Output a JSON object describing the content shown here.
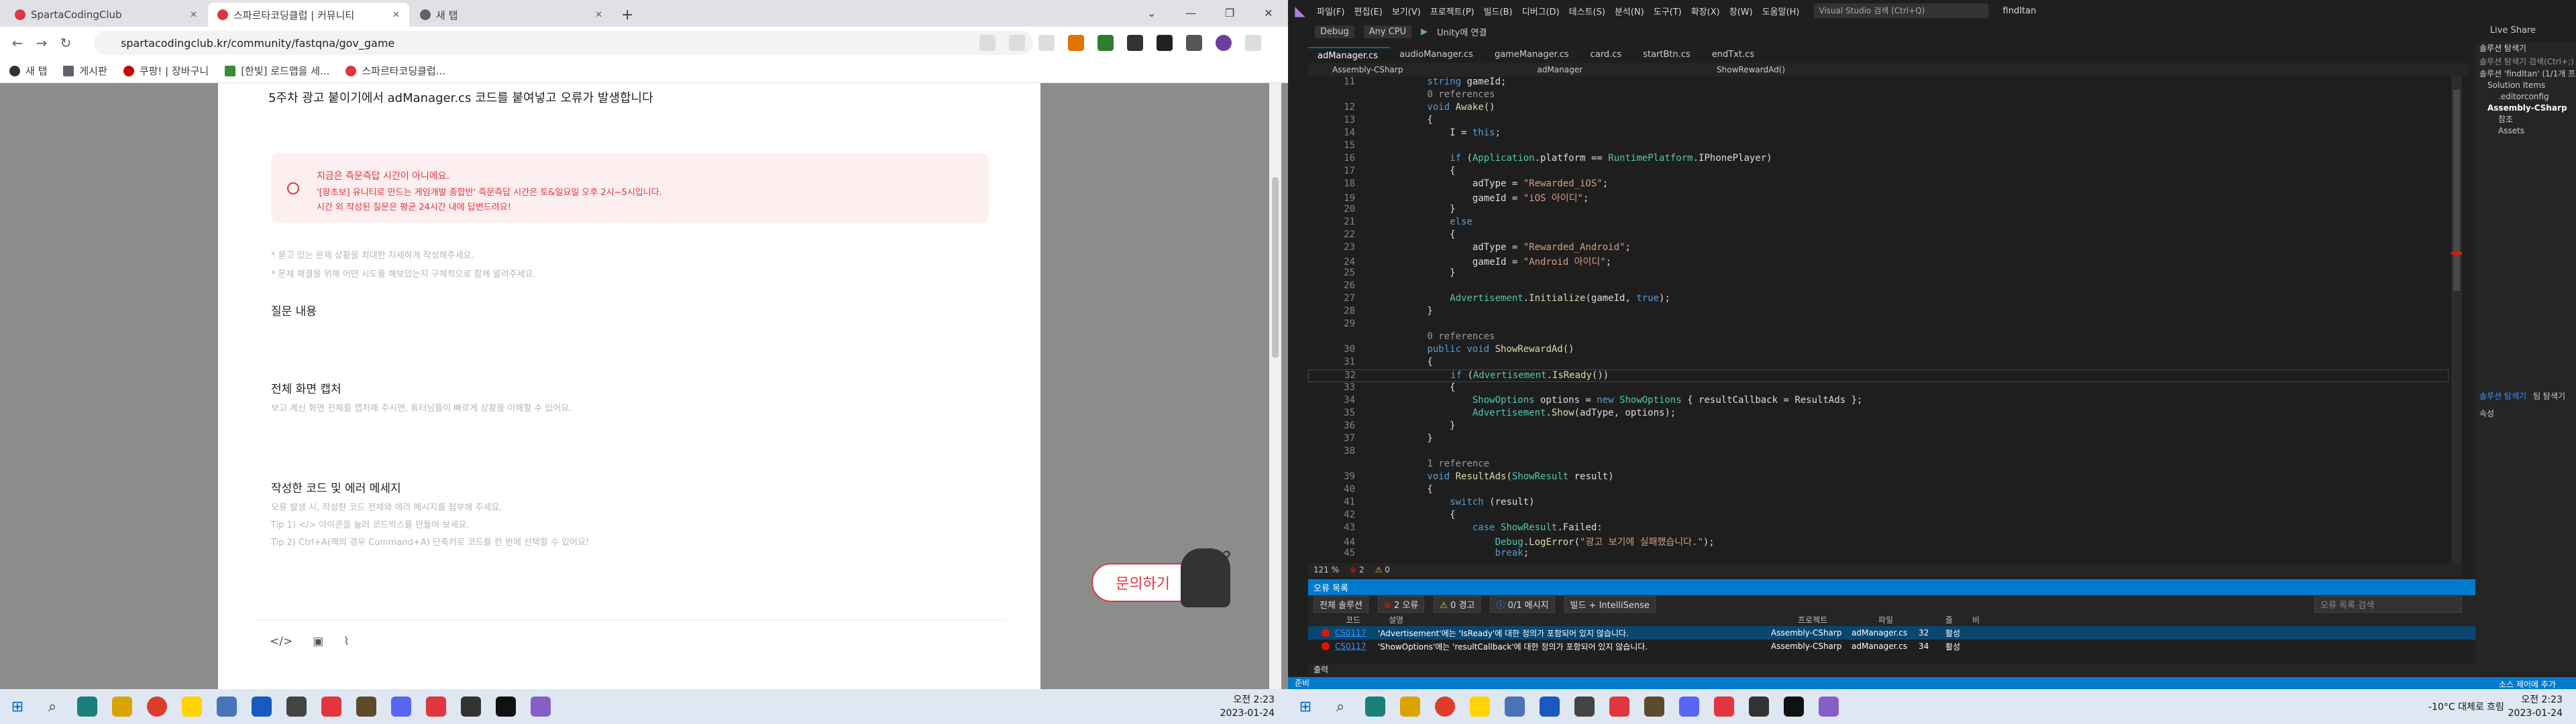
{
  "browser": {
    "tabs": [
      {
        "title": "SpartaCodingClub",
        "color": "#e1353f"
      },
      {
        "title": "스파르타코딩클럽 | 커뮤니티",
        "color": "#e1353f"
      },
      {
        "title": "새 탭",
        "color": "#5f6368"
      }
    ],
    "new_tab": "+",
    "url": "spartacodingclub.kr/community/fastqna/gov_game",
    "bookmarks": [
      "새 탭",
      "게시판",
      "쿠팡! | 장바구니",
      "[한빛] 로드맵을 세...",
      "스파르타코딩클럽..."
    ]
  },
  "page": {
    "question_title": "5주차 광고 붙이기에서 adManager.cs 코드를 붙여넣고 오류가 발생합니다",
    "notice_title": "지금은 즉문즉답 시간이 아니에요.",
    "notice_line1": "'[왕초보] 유니티로 만드는 게임개발 종합반' 즉문즉답 시간은 토&일요일 오후 2시~5시입니다.",
    "notice_line2": "시간 외 작성된 질문은 평균 24시간 내에 답변드려요!",
    "hint1": "* 묻고 있는 문제 상황을 최대한 자세하게 작성해주세요.",
    "hint2": "* 문제 해결을 위해 어떤 시도를 해보았는지 구체적으로 함께 알려주세요.",
    "sec_question": "질문 내용",
    "sec_screenshot": "전체 화면 캡처",
    "sub_screenshot": "보고 계신 화면 전체를 캡처해 주시면, 튜터님들이 빠르게 상황을 이해할 수 있어요.",
    "sec_code": "작성한 코드 및 에러 메세지",
    "sub_code1": "오류 발생 시, 작성한 코드 전체와 에러 메시지를 첨부해 주세요.",
    "sub_code2": "Tip 1) </> 아이콘을 눌러 코드박스를 만들어 보세요.",
    "sub_code3": "Tip 2) Ctrl+A(맥의 경우 Command+A) 단축키로 코드를 한 번에 선택할 수 있어요!",
    "ask_button": "문의하기",
    "editor_icons": [
      "</>",
      "▣",
      "⌇"
    ]
  },
  "taskbar_left": {
    "time": "오전 2:23",
    "date": "2023-01-24"
  },
  "vs": {
    "menu": [
      "파일(F)",
      "편집(E)",
      "보기(V)",
      "프로젝트(P)",
      "빌드(B)",
      "디버그(D)",
      "테스트(S)",
      "분석(N)",
      "도구(T)",
      "확장(X)",
      "창(W)",
      "도움말(H)"
    ],
    "search_placeholder": "Visual Studio 검색 (Ctrl+Q)",
    "solution_name": "findItan",
    "config": "Debug",
    "platform": "Any CPU",
    "run_label": "Unity에 연결",
    "live_share": "Live Share",
    "file_tabs": [
      "adManager.cs",
      "audioManager.cs",
      "gameManager.cs",
      "card.cs",
      "startBtn.cs",
      "endTxt.cs"
    ],
    "nav_project": "Assembly-CSharp",
    "nav_class": "adManager",
    "nav_member": "ShowRewardAd()",
    "zoom": "121 %",
    "err_count": "2",
    "warn_count": "0",
    "error_list_title": "오류 목록",
    "scope": "전체 솔루션",
    "errors_badge": "2 오류",
    "warnings_badge": "0 경고",
    "messages_badge": "0/1 메시지",
    "build_filter": "빌드 + IntelliSense",
    "err_search": "오류 목록 검색",
    "columns": [
      "코드",
      "설명",
      "프로젝트",
      "파일",
      "줄",
      "비"
    ],
    "errors": [
      {
        "code": "CS0117",
        "desc": "'Advertisement'에는 'IsReady'에 대한 정의가 포함되어 있지 않습니다.",
        "project": "Assembly-CSharp",
        "file": "adManager.cs",
        "line": "32",
        "state": "활성"
      },
      {
        "code": "CS0117",
        "desc": "'ShowOptions'에는 'resultCallback'에 대한 정의가 포함되어 있지 않습니다.",
        "project": "Assembly-CSharp",
        "file": "adManager.cs",
        "line": "34",
        "state": "활성"
      }
    ],
    "output_tab": "출력",
    "status_ready": "준비",
    "status_right": "소스 제어에 추가",
    "solution_explorer": "솔루션 탐색기",
    "solution_search": "솔루션 탐색기 검색(Ctrl+;)",
    "tree": [
      "솔루션 'findItan' (1/1개 프로젝트)",
      "Solution Items",
      ".editorconfig",
      "Assembly-CSharp",
      "참조",
      "Assets"
    ],
    "team_tab": "솔루션 탐색기",
    "team_tab2": "팀 탐색기",
    "props": "속성"
  },
  "code": [
    {
      "n": "11",
      "html": "        <span class='k'>string</span> gameId;"
    },
    {
      "n": "",
      "html": "        <span class='ref'>0 references</span>"
    },
    {
      "n": "12",
      "html": "        <span class='k'>void</span> <span class='m'>Awake</span>()"
    },
    {
      "n": "13",
      "html": "        {"
    },
    {
      "n": "14",
      "html": "            I = <span class='k'>this</span>;"
    },
    {
      "n": "15",
      "html": ""
    },
    {
      "n": "16",
      "html": "            <span class='k'>if</span> (<span class='t'>Application</span>.platform == <span class='t'>RuntimePlatform</span>.IPhonePlayer)"
    },
    {
      "n": "17",
      "html": "            {"
    },
    {
      "n": "18",
      "html": "                adType = <span class='s'>\"Rewarded_iOS\"</span>;"
    },
    {
      "n": "19",
      "html": "                gameId = <span class='s'>\"iOS 아이디\"</span>;"
    },
    {
      "n": "20",
      "html": "            }"
    },
    {
      "n": "21",
      "html": "            <span class='k'>else</span>"
    },
    {
      "n": "22",
      "html": "            {"
    },
    {
      "n": "23",
      "html": "                adType = <span class='s'>\"Rewarded_Android\"</span>;"
    },
    {
      "n": "24",
      "html": "                gameId = <span class='s'>\"Android 아이디\"</span>;"
    },
    {
      "n": "25",
      "html": "            }"
    },
    {
      "n": "26",
      "html": ""
    },
    {
      "n": "27",
      "html": "            <span class='t'>Advertisement</span>.<span class='m'>Initialize</span>(gameId, <span class='k'>true</span>);"
    },
    {
      "n": "28",
      "html": "        }"
    },
    {
      "n": "29",
      "html": ""
    },
    {
      "n": "",
      "html": "        <span class='ref'>0 references</span>"
    },
    {
      "n": "30",
      "html": "        <span class='k'>public void</span> <span class='m'>ShowRewardAd</span>()"
    },
    {
      "n": "31",
      "html": "        {"
    },
    {
      "n": "32",
      "html": "            <span class='k'>if</span> (<span class='t'>Advertisement</span>.<span class='m'>IsReady</span>())"
    },
    {
      "n": "33",
      "html": "            {"
    },
    {
      "n": "34",
      "html": "                <span class='t'>ShowOptions</span> options = <span class='k'>new</span> <span class='t'>ShowOptions</span> { resultCallback = ResultAds };"
    },
    {
      "n": "35",
      "html": "                <span class='t'>Advertisement</span>.<span class='m'>Show</span>(adType, options);"
    },
    {
      "n": "36",
      "html": "            }"
    },
    {
      "n": "37",
      "html": "        }"
    },
    {
      "n": "38",
      "html": ""
    },
    {
      "n": "",
      "html": "        <span class='ref'>1 reference</span>"
    },
    {
      "n": "39",
      "html": "        <span class='k'>void</span> <span class='m'>ResultAds</span>(<span class='t'>ShowResult</span> result)"
    },
    {
      "n": "40",
      "html": "        {"
    },
    {
      "n": "41",
      "html": "            <span class='k'>switch</span> (result)"
    },
    {
      "n": "42",
      "html": "            {"
    },
    {
      "n": "43",
      "html": "                <span class='k'>case</span> <span class='t'>ShowResult</span>.Failed:"
    },
    {
      "n": "44",
      "html": "                    <span class='t'>Debug</span>.<span class='m'>LogError</span>(<span class='s'>\"광고 보기에 실패했습니다.\"</span>);"
    },
    {
      "n": "45",
      "html": "                    <span class='k'>break</span>;"
    }
  ],
  "taskbar_right": {
    "weather": "-10°C 대체로 흐림",
    "time": "오전 2:23",
    "date": "2023-01-24"
  }
}
